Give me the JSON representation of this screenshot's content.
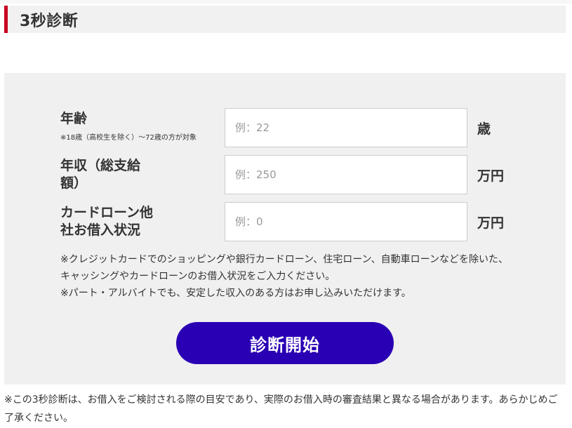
{
  "header": {
    "title": "3秒診断"
  },
  "form": {
    "fields": [
      {
        "label": "年齢",
        "sub_label": "※18歳（高校生を除く）～72歳の方が対象",
        "placeholder": "例：22",
        "unit": "歳"
      },
      {
        "label": "年収（総支給額）",
        "placeholder": "例：250",
        "unit": "万円"
      },
      {
        "label": "カードローン他社お借入状況",
        "placeholder": "例：0",
        "unit": "万円"
      }
    ],
    "notes": [
      "※クレジットカードでのショッピングや銀行カードローン、住宅ローン、自動車ローンなどを除いた、キャッシングやカードローンのお借入状況をご入力ください。",
      "※パート・アルバイトでも、安定した収入のある方はお申し込みいただけます。"
    ],
    "submit_label": "診断開始"
  },
  "footer": {
    "disclaimer": "※この3秒診断は、お借入をご検討される際の目安であり、実際のお借入時の審査結果と異なる場合があります。あらかじめご了承ください。"
  },
  "colors": {
    "accent_red": "#c8001e",
    "button_blue": "#2a00b4",
    "panel_bg": "#f0f0f0"
  }
}
